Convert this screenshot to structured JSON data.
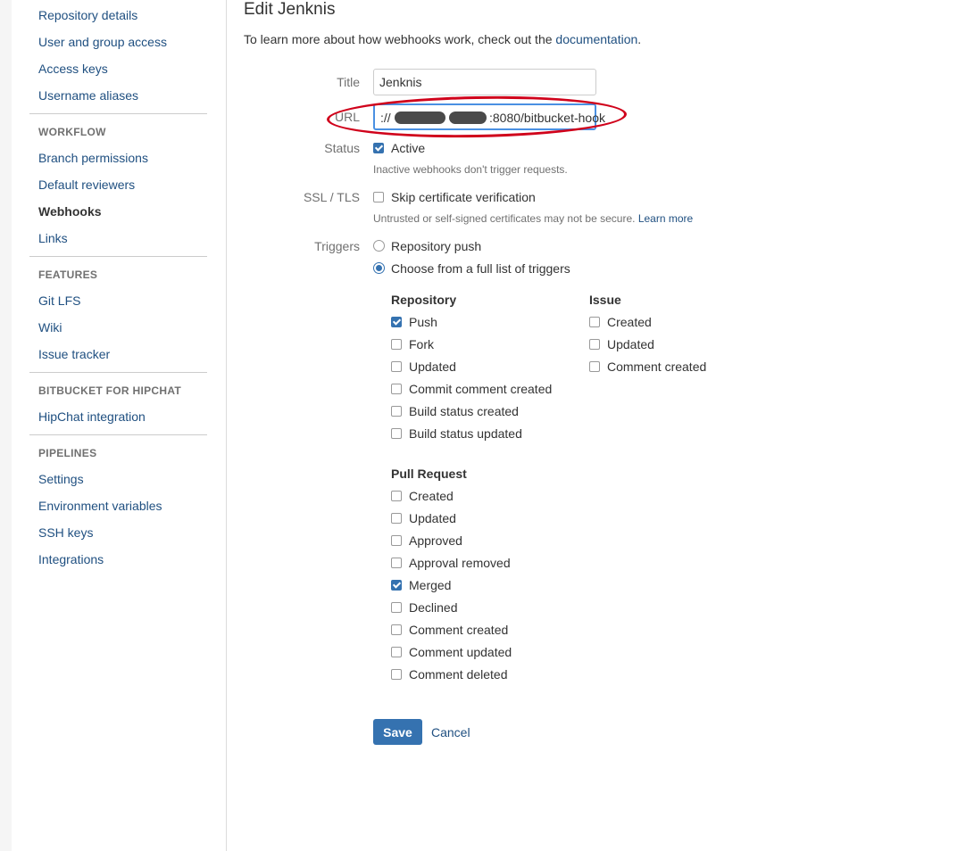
{
  "sidebar": {
    "top_items": [
      "Repository details",
      "User and group access",
      "Access keys",
      "Username aliases"
    ],
    "sections": [
      {
        "heading": "WORKFLOW",
        "items": [
          "Branch permissions",
          "Default reviewers",
          "Webhooks",
          "Links"
        ]
      },
      {
        "heading": "FEATURES",
        "items": [
          "Git LFS",
          "Wiki",
          "Issue tracker"
        ]
      },
      {
        "heading": "BITBUCKET FOR HIPCHAT",
        "items": [
          "HipChat integration"
        ]
      },
      {
        "heading": "PIPELINES",
        "items": [
          "Settings",
          "Environment variables",
          "SSH keys",
          "Integrations"
        ]
      }
    ],
    "active_item": "Webhooks"
  },
  "page": {
    "title": "Edit Jenknis",
    "intro_text": "To learn more about how webhooks work, check out the",
    "intro_link": "documentation",
    "intro_end": "."
  },
  "form": {
    "title_label": "Title",
    "title_value": "Jenknis",
    "url_label": "URL",
    "url_value_start": "://",
    "url_value_end": ":8080/bitbucket-hook",
    "status_label": "Status",
    "status_option": "Active",
    "status_checked": true,
    "status_help": "Inactive webhooks don't trigger requests.",
    "ssl_label": "SSL / TLS",
    "ssl_option": "Skip certificate verification",
    "ssl_checked": false,
    "ssl_help": "Untrusted or self-signed certificates may not be secure.",
    "ssl_help_link": "Learn more",
    "triggers_label": "Triggers",
    "trigger_options": [
      {
        "label": "Repository push",
        "selected": false
      },
      {
        "label": "Choose from a full list of triggers",
        "selected": true
      }
    ]
  },
  "trigger_groups": {
    "repository": {
      "title": "Repository",
      "items": [
        {
          "label": "Push",
          "checked": true
        },
        {
          "label": "Fork",
          "checked": false
        },
        {
          "label": "Updated",
          "checked": false
        },
        {
          "label": "Commit comment created",
          "checked": false
        },
        {
          "label": "Build status created",
          "checked": false
        },
        {
          "label": "Build status updated",
          "checked": false
        }
      ]
    },
    "issue": {
      "title": "Issue",
      "items": [
        {
          "label": "Created",
          "checked": false
        },
        {
          "label": "Updated",
          "checked": false
        },
        {
          "label": "Comment created",
          "checked": false
        }
      ]
    },
    "pull_request": {
      "title": "Pull Request",
      "items": [
        {
          "label": "Created",
          "checked": false
        },
        {
          "label": "Updated",
          "checked": false
        },
        {
          "label": "Approved",
          "checked": false
        },
        {
          "label": "Approval removed",
          "checked": false
        },
        {
          "label": "Merged",
          "checked": true
        },
        {
          "label": "Declined",
          "checked": false
        },
        {
          "label": "Comment created",
          "checked": false
        },
        {
          "label": "Comment updated",
          "checked": false
        },
        {
          "label": "Comment deleted",
          "checked": false
        }
      ]
    }
  },
  "actions": {
    "save_label": "Save",
    "cancel_label": "Cancel"
  },
  "colors": {
    "link": "#205081",
    "primary": "#3572b0",
    "annotation": "#d0021b",
    "focus": "#4a90e2"
  }
}
